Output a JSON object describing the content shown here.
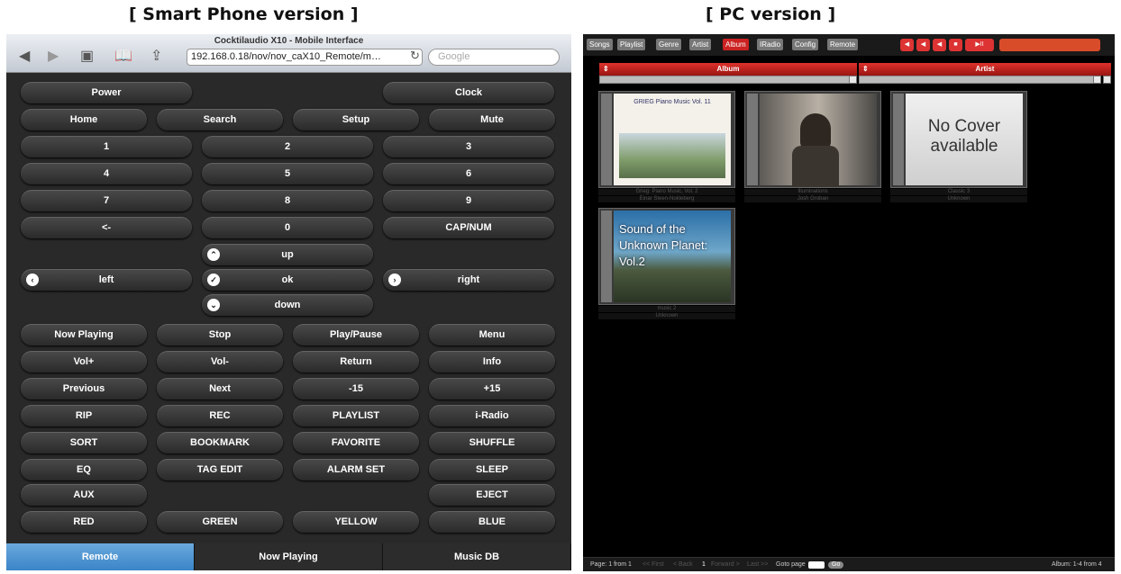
{
  "captions": {
    "phone": "[ Smart Phone version ]",
    "pc": "[ PC version ]"
  },
  "phone": {
    "browser": {
      "title": "Cocktilaudio X10 - Mobile Interface",
      "url": "192.168.0.18/nov/nov_caX10_Remote/m…",
      "search_placeholder": "Google"
    },
    "buttons": {
      "power": "Power",
      "clock": "Clock",
      "home": "Home",
      "search": "Search",
      "setup": "Setup",
      "mute": "Mute",
      "n1": "1",
      "n2": "2",
      "n3": "3",
      "n4": "4",
      "n5": "5",
      "n6": "6",
      "n7": "7",
      "n8": "8",
      "n9": "9",
      "back": "<-",
      "n0": "0",
      "capnum": "CAP/NUM",
      "up": "up",
      "left": "left",
      "ok": "ok",
      "right": "right",
      "down": "down",
      "now_playing": "Now Playing",
      "stop": "Stop",
      "play_pause": "Play/Pause",
      "menu": "Menu",
      "vol_up": "Vol+",
      "vol_down": "Vol-",
      "return": "Return",
      "info": "Info",
      "previous": "Previous",
      "next": "Next",
      "minus15": "-15",
      "plus15": "+15",
      "rip": "RIP",
      "rec": "REC",
      "playlist": "PLAYLIST",
      "iradio": "i-Radio",
      "sort": "SORT",
      "bookmark": "BOOKMARK",
      "favorite": "FAVORITE",
      "shuffle": "SHUFFLE",
      "eq": "EQ",
      "tag_edit": "TAG EDIT",
      "alarm_set": "ALARM SET",
      "sleep": "SLEEP",
      "aux": "AUX",
      "eject": "EJECT",
      "red": "RED",
      "green": "GREEN",
      "yellow": "YELLOW",
      "blue": "BLUE"
    },
    "tabs": {
      "remote": "Remote",
      "now_playing": "Now Playing",
      "music_db": "Music DB"
    }
  },
  "pc": {
    "tabs": {
      "songs": "Songs",
      "playlist": "Playlist",
      "genre": "Genre",
      "artist": "Artist",
      "album": "Album",
      "iradio": "IRadio",
      "config": "Config",
      "remote": "Remote"
    },
    "columns": {
      "album": "Album",
      "artist": "Artist"
    },
    "albums": [
      {
        "title": "Grieg: Piano Music, Vol. 2",
        "artist": "Einar Steen-Nokleberg",
        "cover_text": "GRIEG Piano Music Vol. 11"
      },
      {
        "title": "Illuminations",
        "artist": "Josh Groban",
        "cover_text": ""
      },
      {
        "title": "Classic 3",
        "artist": "Unknown",
        "cover_text": "No Cover available"
      },
      {
        "title": "music 2",
        "artist": "Unknown",
        "cover_text": "Sound of the Unknown Planet: Vol.2"
      }
    ],
    "footer": {
      "page": "Page: 1 from 1",
      "first": "<< First",
      "back": "< Back",
      "current": "1",
      "forward": "Forward >",
      "last": "Last >>",
      "goto": "Goto page",
      "go": "Go",
      "count": "Album: 1-4 from 4"
    },
    "colors": {
      "accent": "#c22222",
      "background": "#000000"
    }
  }
}
